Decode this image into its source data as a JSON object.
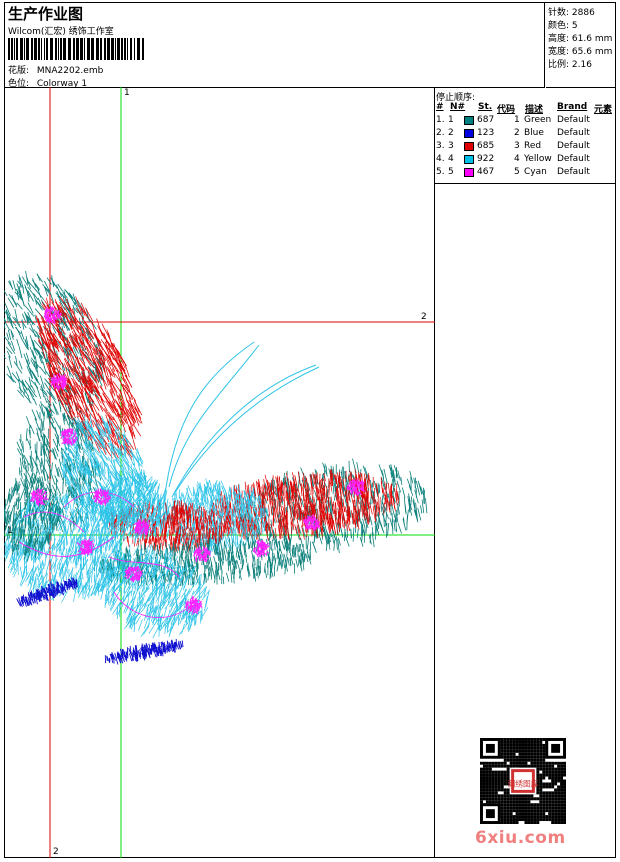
{
  "header": {
    "title": "生产作业图",
    "company": "Wilcom(汇宏) 绣饰工作室",
    "design_label": "花版:",
    "design_value": "MNA2202.emb",
    "colorway_label": "色位:",
    "colorway_value": "Colorway 1"
  },
  "stats": [
    {
      "label": "针数:",
      "value": "2886"
    },
    {
      "label": "颜色:",
      "value": "5"
    },
    {
      "label": "高度:",
      "value": "61.6 mm"
    },
    {
      "label": "宽度:",
      "value": "65.6 mm"
    },
    {
      "label": "比例:",
      "value": "2.16"
    }
  ],
  "stop_sequence": {
    "title": "停止顺序:",
    "headers": [
      "#",
      "N#",
      "St.",
      "代码",
      "描述",
      "Brand",
      "元素"
    ],
    "rows": [
      {
        "idx": "1.",
        "n": "1",
        "color": "#008080",
        "st": "687",
        "code": "1",
        "desc": "Green",
        "brand": "Default"
      },
      {
        "idx": "2.",
        "n": "2",
        "color": "#0000e0",
        "st": "123",
        "code": "2",
        "desc": "Blue",
        "brand": "Default"
      },
      {
        "idx": "3.",
        "n": "3",
        "color": "#e00000",
        "st": "685",
        "code": "3",
        "desc": "Red",
        "brand": "Default"
      },
      {
        "idx": "4.",
        "n": "4",
        "color": "#00c0e8",
        "st": "922",
        "code": "4",
        "desc": "Yellow",
        "brand": "Default"
      },
      {
        "idx": "5.",
        "n": "5",
        "color": "#ff00ff",
        "st": "467",
        "code": "5",
        "desc": "Cyan",
        "brand": "Default"
      }
    ]
  },
  "axis_labels": {
    "green_top": "1",
    "green_left": "1",
    "red_right": "2",
    "red_bottom": "2"
  },
  "watermark": "6xiu.com",
  "qr_stamp": "刺绣图库",
  "colors": {
    "green": "#00dd00",
    "red": "#e00000",
    "teal": "#0a7f7a",
    "cyan": "#2ec4e8",
    "magenta": "#ff20ff",
    "blue": "#1010d0"
  }
}
